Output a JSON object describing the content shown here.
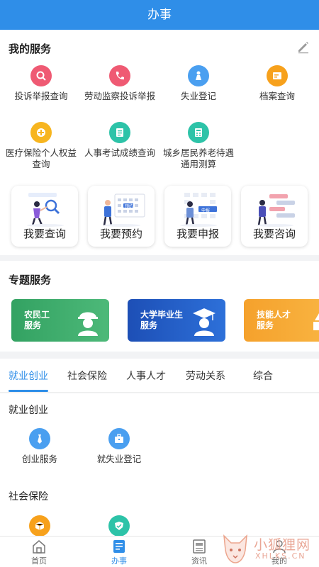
{
  "header": {
    "title": "办事"
  },
  "my_services": {
    "title": "我的服务",
    "edit_icon": "pencil-icon",
    "items": [
      {
        "label": "投诉举报查询",
        "icon": "search-icon",
        "color": "#ef5a73"
      },
      {
        "label": "劳动监察投诉举报",
        "icon": "phone-icon",
        "color": "#ef5a73"
      },
      {
        "label": "失业登记",
        "icon": "person-icon",
        "color": "#4a9ff0"
      },
      {
        "label": "档案查询",
        "icon": "folder-icon",
        "color": "#f7a11c"
      },
      {
        "label": "医疗保险个人权益查询",
        "icon": "medical-icon",
        "color": "#f7b51f"
      },
      {
        "label": "人事考试成绩查询",
        "icon": "document-icon",
        "color": "#2dc3a8"
      },
      {
        "label": "城乡居民养老待遇通用测算",
        "icon": "calculator-icon",
        "color": "#2dc3a8"
      }
    ],
    "cards": [
      {
        "label": "我要查询",
        "tag": ""
      },
      {
        "label": "我要预约",
        "tag": "预约"
      },
      {
        "label": "我要申报",
        "tag": "申报"
      },
      {
        "label": "我要咨询",
        "tag": ""
      }
    ]
  },
  "topic_services": {
    "title": "专题服务",
    "banners": [
      {
        "line1": "农民工",
        "line2": "服务",
        "color": "#3aa86b"
      },
      {
        "line1": "大学毕业生",
        "line2": "服务",
        "color": "#2460c6"
      },
      {
        "line1": "技能人才",
        "line2": "服务",
        "color": "#f59a2a"
      }
    ]
  },
  "tabs": [
    "就业创业",
    "社会保险",
    "人事人才",
    "劳动关系",
    "综合"
  ],
  "active_tab": "就业创业",
  "employment": {
    "title": "就业创业",
    "items": [
      {
        "label": "创业服务",
        "icon": "tie-icon",
        "color": "#4a9ff0"
      },
      {
        "label": "就失业登记",
        "icon": "briefcase-icon",
        "color": "#4a9ff0"
      }
    ]
  },
  "social_insurance": {
    "title": "社会保险",
    "items": [
      {
        "label": "",
        "icon": "box-icon",
        "color": "#f7a11c"
      },
      {
        "label": "",
        "icon": "shield-icon",
        "color": "#2dc3a8"
      }
    ]
  },
  "bottom_nav": [
    {
      "label": "首页",
      "icon": "home-icon"
    },
    {
      "label": "办事",
      "icon": "service-icon"
    },
    {
      "label": "资讯",
      "icon": "news-icon"
    },
    {
      "label": "我的",
      "icon": "profile-icon"
    }
  ],
  "watermark": {
    "line1": "小狐狸网",
    "line2": "XHLKS.CN"
  }
}
